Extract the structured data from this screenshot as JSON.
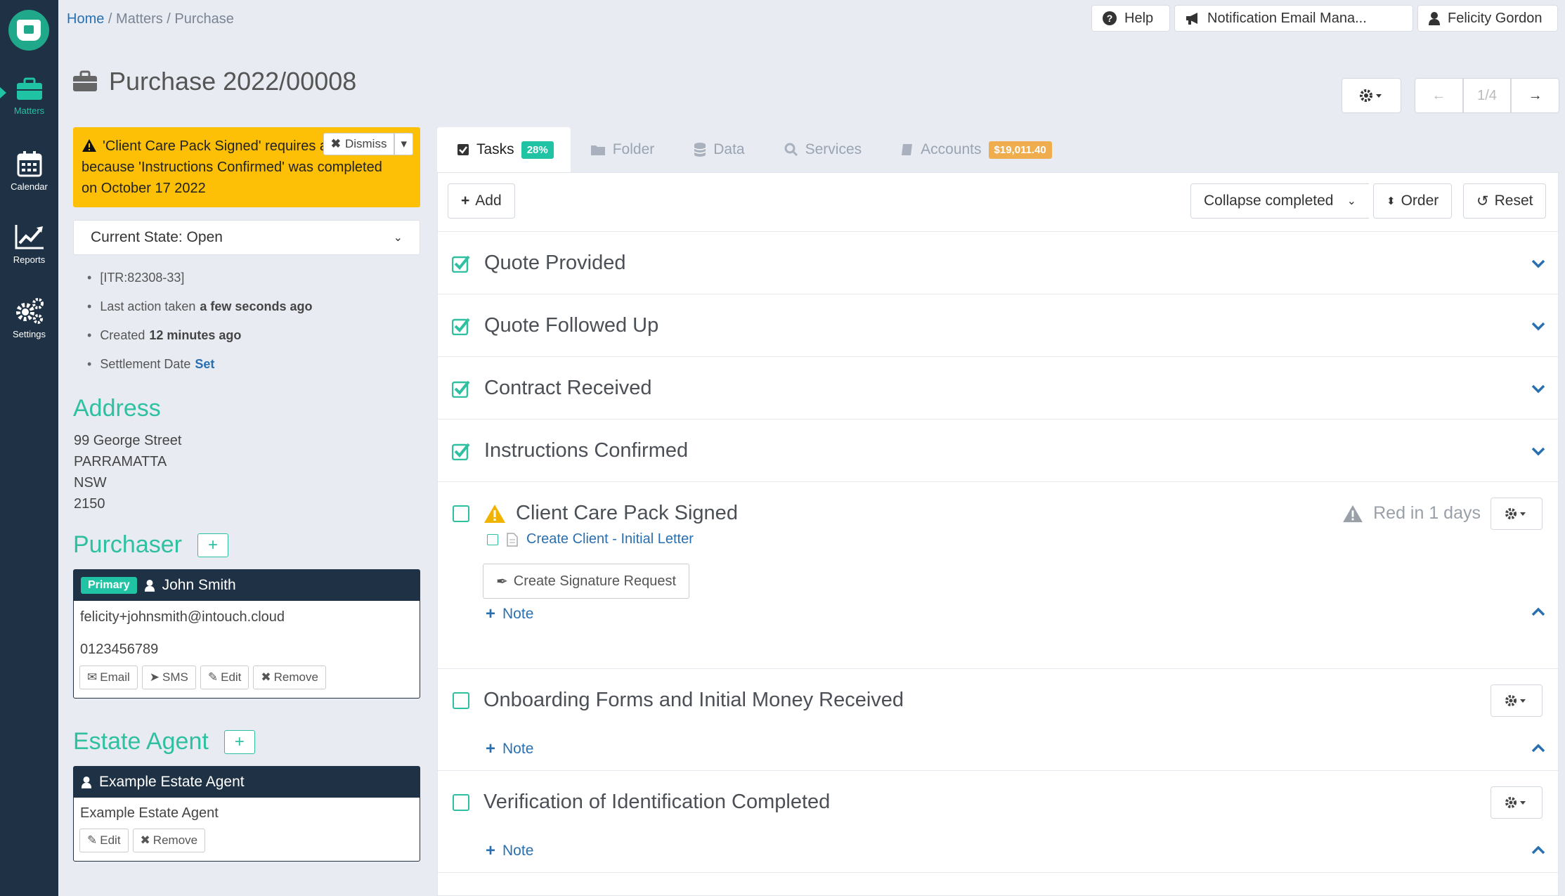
{
  "sidebar": {
    "items": [
      {
        "label": "Matters",
        "icon": "briefcase-icon"
      },
      {
        "label": "Calendar",
        "icon": "calendar-icon"
      },
      {
        "label": "Reports",
        "icon": "chart-icon"
      },
      {
        "label": "Settings",
        "icon": "cogs-icon"
      }
    ]
  },
  "breadcrumb": {
    "home": "Home",
    "sep": "/",
    "matters": "Matters",
    "current": "Purchase"
  },
  "header": {
    "help": "Help",
    "notification": "Notification Email Mana...",
    "user": "Felicity Gordon"
  },
  "page": {
    "title": "Purchase 2022/00008"
  },
  "pager": {
    "prev": "←",
    "position": "1/4",
    "next": "→"
  },
  "alert": {
    "text": "'Client Care Pack Signed' requires attention because 'Instructions Confirmed' was completed on October 17 2022",
    "dismiss": "Dismiss"
  },
  "state": {
    "label": "Current State: Open"
  },
  "meta": {
    "ref": "[ITR:82308-33]",
    "last_action_label": "Last action taken",
    "last_action_value": "a few seconds ago",
    "created_label": "Created",
    "created_value": "12 minutes ago",
    "settlement_label": "Settlement Date",
    "settlement_value": "Set"
  },
  "address": {
    "title": "Address",
    "lines": [
      "99 George Street",
      "PARRAMATTA",
      "NSW",
      "2150"
    ]
  },
  "purchaser": {
    "title": "Purchaser",
    "badge": "Primary",
    "name": "John Smith",
    "email": "felicity+johnsmith@intouch.cloud",
    "phone": "0123456789",
    "actions": {
      "email": "Email",
      "sms": "SMS",
      "edit": "Edit",
      "remove": "Remove"
    }
  },
  "estate_agent": {
    "title": "Estate Agent",
    "name": "Example Estate Agent",
    "detail": "Example Estate Agent",
    "actions": {
      "edit": "Edit",
      "remove": "Remove"
    }
  },
  "tabs": [
    {
      "label": "Tasks",
      "badge": "28%"
    },
    {
      "label": "Folder"
    },
    {
      "label": "Data"
    },
    {
      "label": "Services"
    },
    {
      "label": "Accounts",
      "badge": "$19,011.40"
    }
  ],
  "toolbar": {
    "add": "Add",
    "collapse": "Collapse completed",
    "order": "Order",
    "reset": "Reset"
  },
  "tasks": [
    {
      "title": "Quote Provided",
      "done": true
    },
    {
      "title": "Quote Followed Up",
      "done": true
    },
    {
      "title": "Contract Received",
      "done": true
    },
    {
      "title": "Instructions Confirmed",
      "done": true
    },
    {
      "title": "Client Care Pack Signed",
      "done": false,
      "warning": true,
      "due": "Red in 1 days",
      "subtask": "Create Client - Initial Letter",
      "action": "Create Signature Request",
      "note": "Note"
    },
    {
      "title": "Onboarding Forms and Initial Money Received",
      "done": false,
      "note": "Note"
    },
    {
      "title": "Verification of Identification Completed",
      "done": false,
      "note": "Note"
    }
  ],
  "colors": {
    "sidebar": "#1f3144",
    "accent": "#2ec0a0",
    "alert": "#fdc007",
    "link": "#2a6fb0",
    "accounts_badge": "#f0ad4e"
  }
}
